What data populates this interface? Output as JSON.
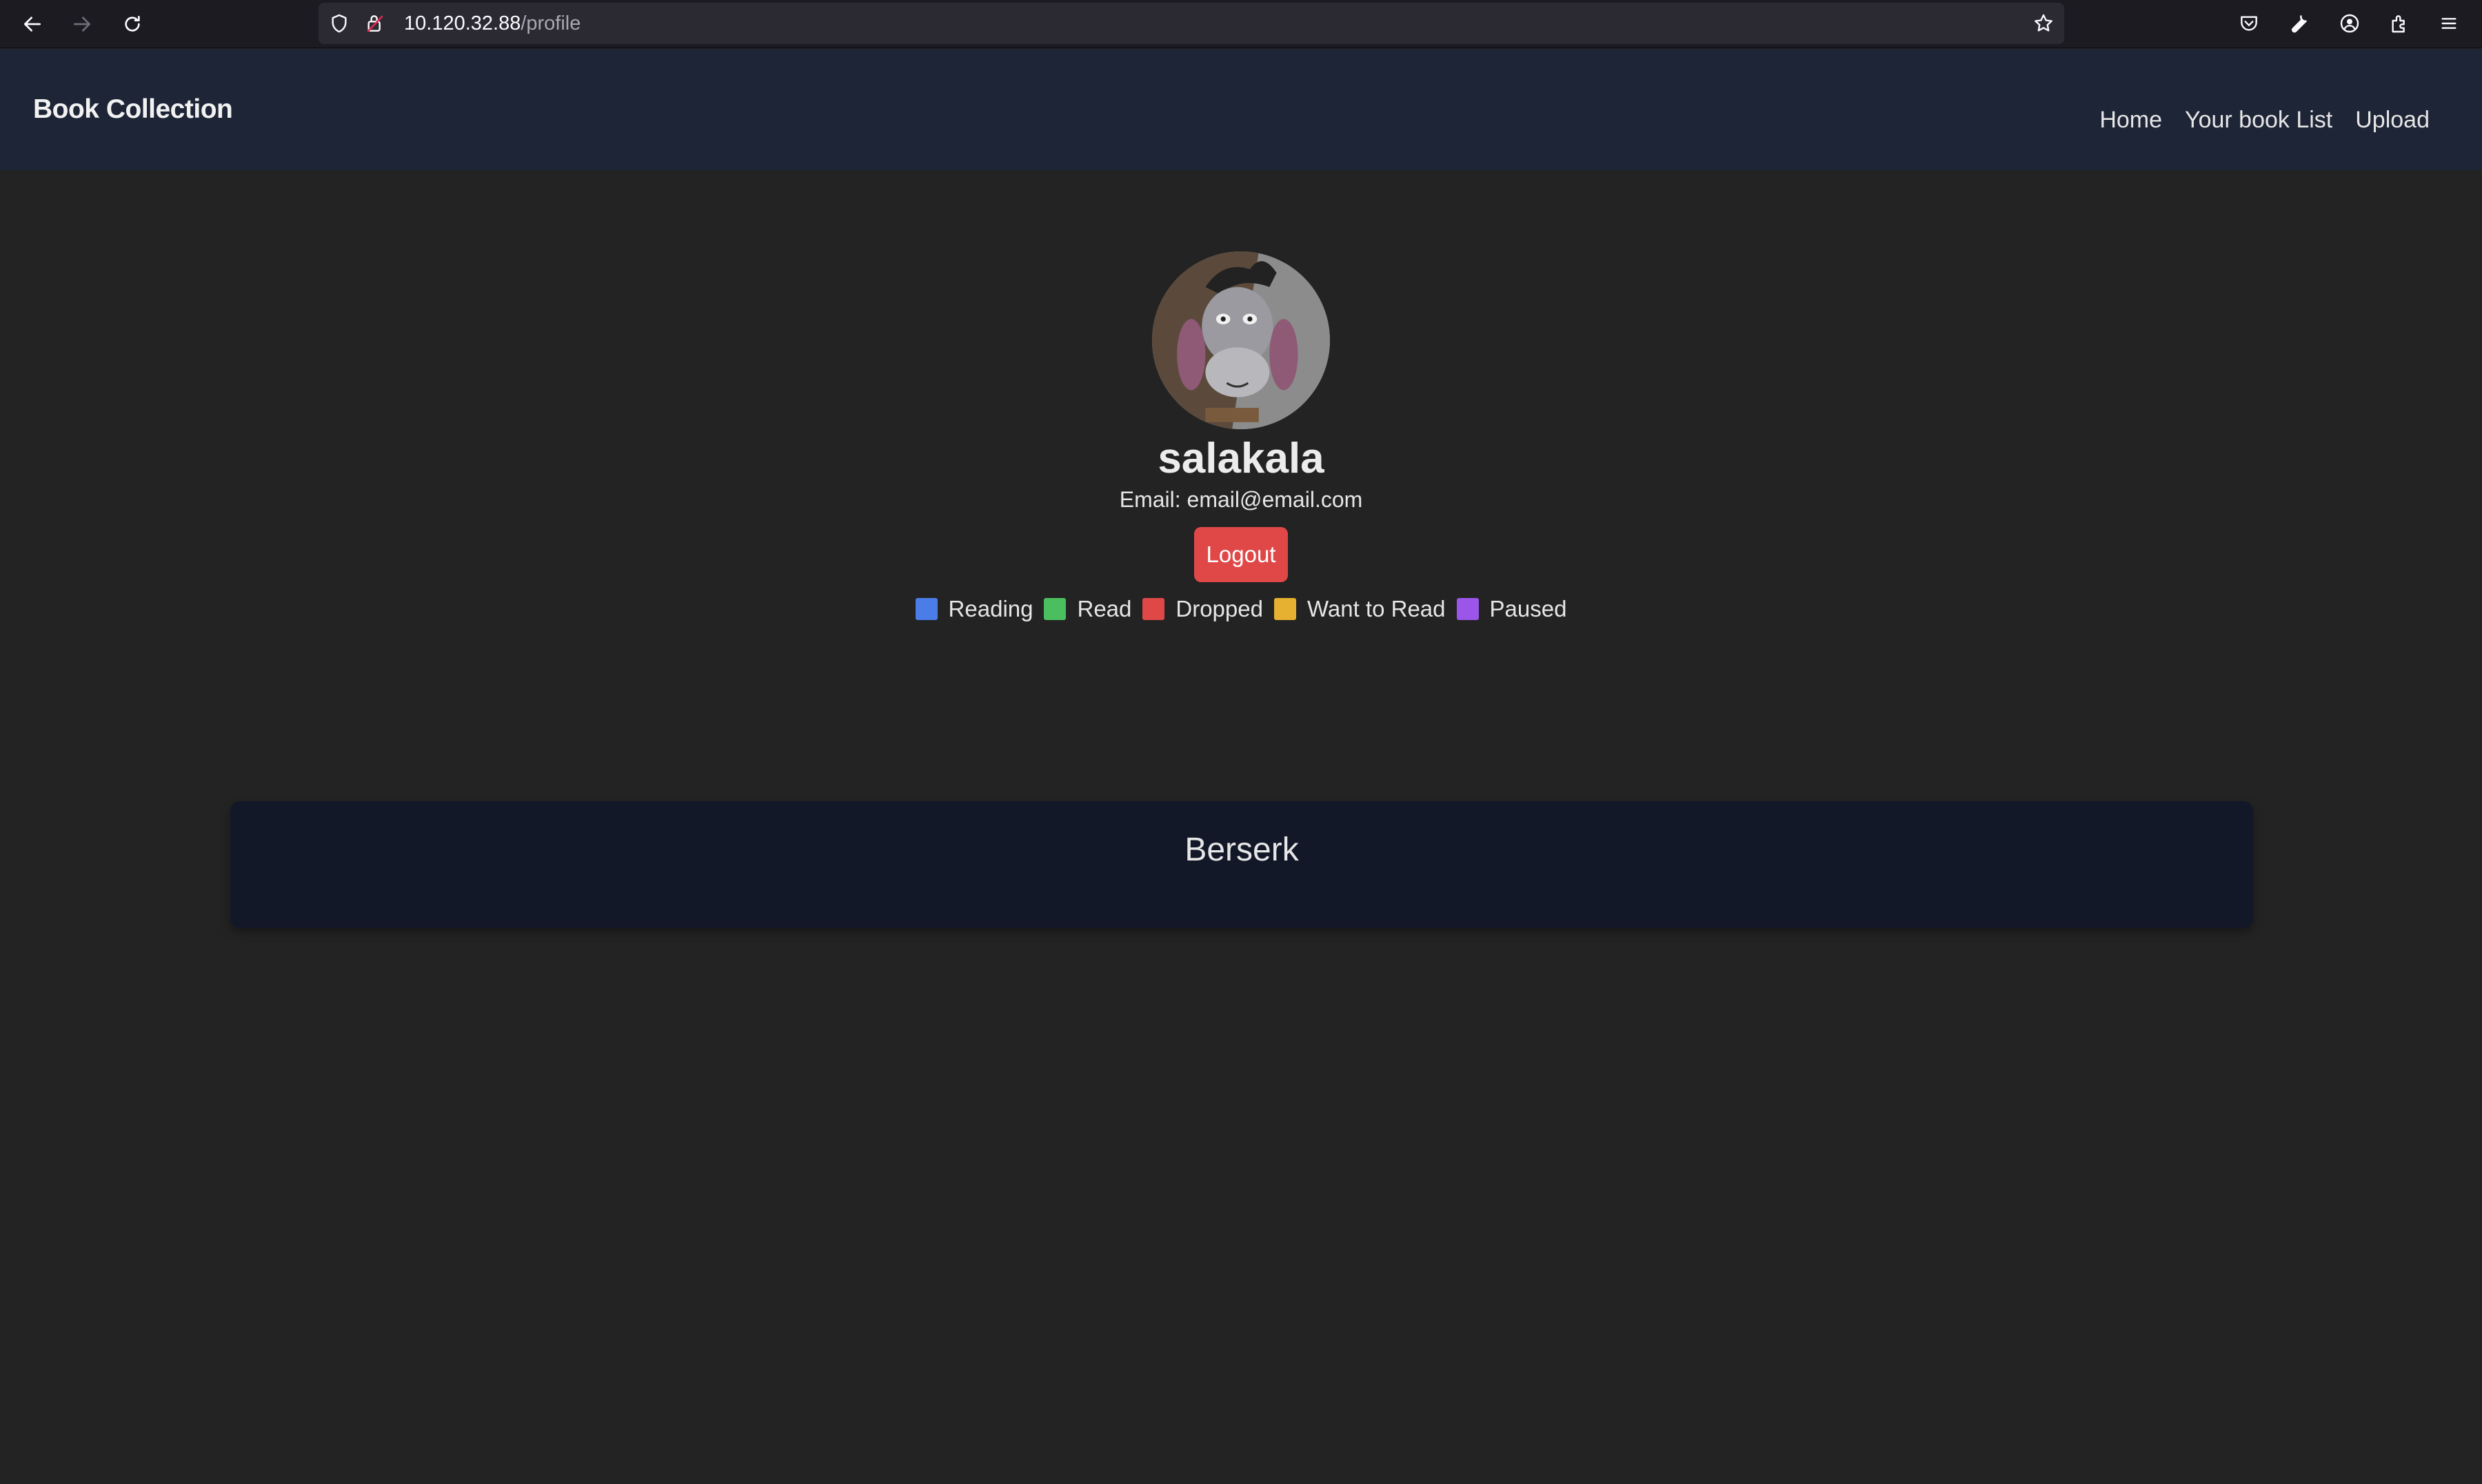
{
  "browser": {
    "url_host": "10.120.32.88",
    "url_path": "/profile"
  },
  "site": {
    "brand": "Book Collection",
    "nav": [
      {
        "label": "Home"
      },
      {
        "label": "Your book List"
      },
      {
        "label": "Upload"
      }
    ]
  },
  "profile": {
    "username": "salakala",
    "email": "Email: email@email.com",
    "logout_label": "Logout"
  },
  "legend": [
    {
      "label": "Reading",
      "color": "#4a7de8"
    },
    {
      "label": "Read",
      "color": "#4bbf5f"
    },
    {
      "label": "Dropped",
      "color": "#e04848"
    },
    {
      "label": "Want to Read",
      "color": "#e6b030"
    },
    {
      "label": "Paused",
      "color": "#9b55e8"
    }
  ],
  "books": [
    {
      "title": "Berserk"
    }
  ],
  "colors": {
    "navbar_bg": "#1e2536",
    "page_bg": "#232323",
    "card_bg": "#131829",
    "logout_bg": "#e04848"
  }
}
